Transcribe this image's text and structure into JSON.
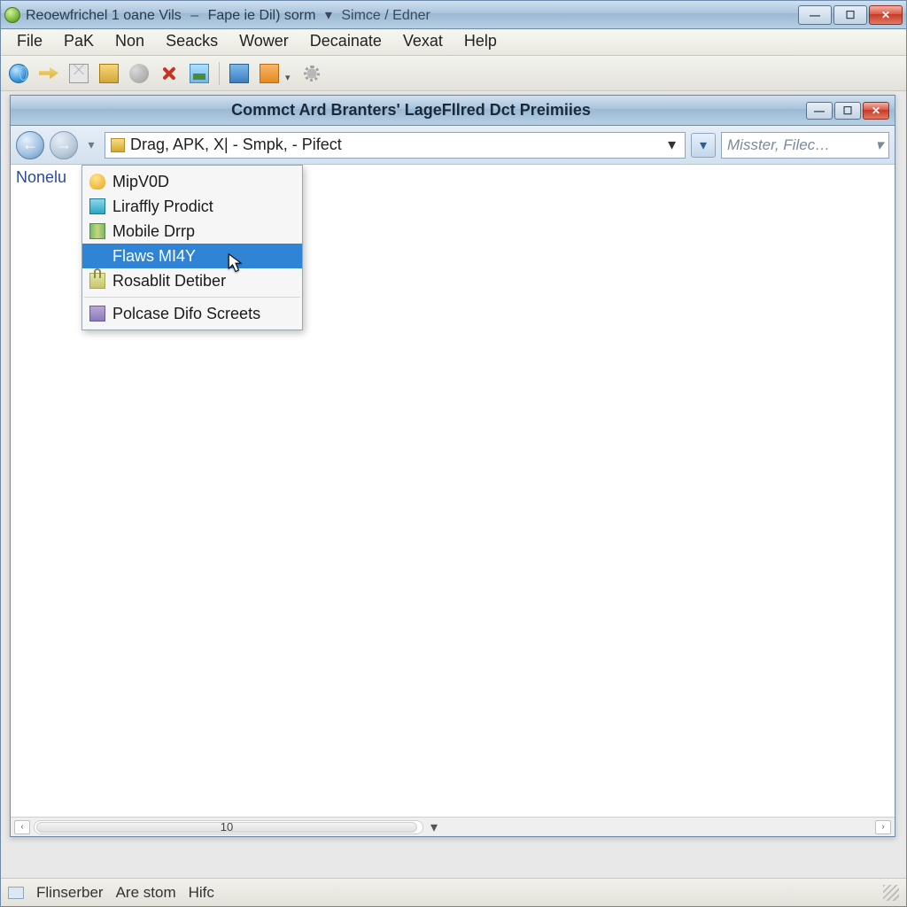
{
  "outer_window": {
    "title_main": "Reoewfrichel 1 oane Vils",
    "title_mid": "Fape ie Dil) sorm",
    "title_after": "Simce / Edner"
  },
  "menubar": {
    "items": [
      "File",
      "PaK",
      "Non",
      "Seacks",
      "Wower",
      "Decainate",
      "Vexat",
      "Help"
    ]
  },
  "inner_window": {
    "title": "Commct Ard Branters' LageFllred Dct Preimiies",
    "address_value": "Drag, APK, X| - Smpk, - Pifect",
    "search_placeholder": "Misster, Filec…",
    "sidebar_text": "Nonelu"
  },
  "dropdown": {
    "items": [
      {
        "icon": "bell",
        "label": "MipV0D"
      },
      {
        "icon": "folder",
        "label": "Liraffly Prodict"
      },
      {
        "icon": "map",
        "label": "Mobile Drrp"
      },
      {
        "icon": "blank",
        "label": "Flaws MI4Y",
        "hover": true
      },
      {
        "icon": "lock",
        "label": "Rosablit Detiber"
      }
    ],
    "footer": {
      "icon": "box",
      "label": "Polcase Difo Screets"
    }
  },
  "hscroll": {
    "label": "10"
  },
  "statusbar": {
    "left": "Flinserber",
    "mid": "Are stom",
    "right": "Hifc"
  }
}
